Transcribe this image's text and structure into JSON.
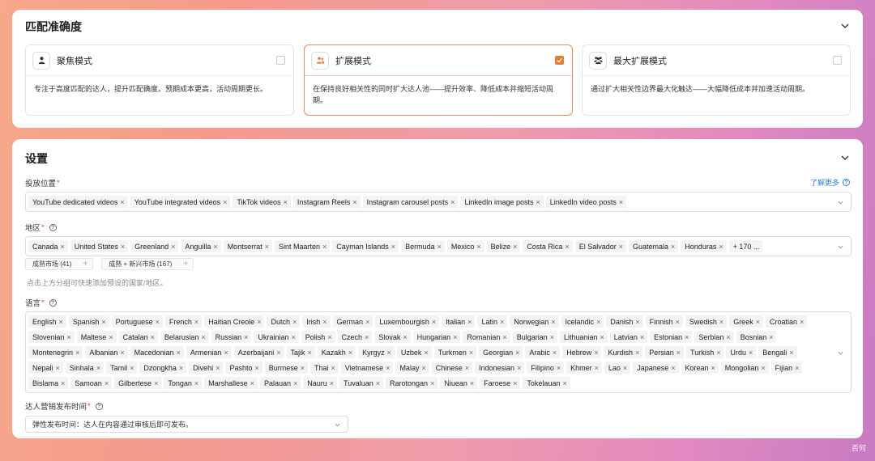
{
  "match": {
    "title": "匹配准确度",
    "modes": [
      {
        "label": "聚焦模式",
        "icon": "person-icon",
        "checked": false,
        "desc": "专注于高度匹配的达人，提升匹配确度。预期成本更高，活动周期更长。"
      },
      {
        "label": "扩展模式",
        "icon": "people-icon",
        "checked": true,
        "desc": "在保持良好相关性的同时扩大达人池——提升效率、降低成本并缩短活动周期。"
      },
      {
        "label": "最大扩展模式",
        "icon": "group-icon",
        "checked": false,
        "desc": "通过扩大相关性边界最大化触达——大幅降低成本并加速活动周期。"
      }
    ]
  },
  "settings": {
    "title": "设置",
    "placement": {
      "label": "投放位置",
      "learn_more": "了解更多",
      "tags": [
        "YouTube dedicated videos",
        "YouTube integrated videos",
        "TikTok videos",
        "Instagram Reels",
        "Instagram carousel posts",
        "LinkedIn image posts",
        "LinkedIn video posts"
      ]
    },
    "region": {
      "label": "地区",
      "tags": [
        "Canada",
        "United States",
        "Greenland",
        "Anguilla",
        "Montserrat",
        "Sint Maarten",
        "Cayman Islands",
        "Bermuda",
        "Mexico",
        "Belize",
        "Costa Rica",
        "El Salvador",
        "Guatemala",
        "Honduras"
      ],
      "more": "+ 170 ...",
      "presets": [
        "成熟市场 (41)",
        "成熟 + 新兴市场 (167)"
      ],
      "hint": "点击上方分组可快速添加预设的国家/地区。"
    },
    "language": {
      "label": "语言",
      "tags": [
        "English",
        "Spanish",
        "Portuguese",
        "French",
        "Haitian Creole",
        "Dutch",
        "Irish",
        "German",
        "Luxembourgish",
        "Italian",
        "Latin",
        "Norwegian",
        "Icelandic",
        "Danish",
        "Finnish",
        "Swedish",
        "Greek",
        "Croatian",
        "Slovenian",
        "Maltese",
        "Catalan",
        "Belarusian",
        "Russian",
        "Ukrainian",
        "Polish",
        "Czech",
        "Slovak",
        "Hungarian",
        "Romanian",
        "Bulgarian",
        "Lithuanian",
        "Latvian",
        "Estonian",
        "Serbian",
        "Bosnian",
        "Montenegrin",
        "Albanian",
        "Macedonian",
        "Armenian",
        "Azerbaijani",
        "Tajik",
        "Kazakh",
        "Kyrgyz",
        "Uzbek",
        "Turkmen",
        "Georgian",
        "Arabic",
        "Hebrew",
        "Kurdish",
        "Persian",
        "Turkish",
        "Urdu",
        "Bengali",
        "Nepali",
        "Sinhala",
        "Tamil",
        "Dzongkha",
        "Divehi",
        "Pashto",
        "Burmese",
        "Thai",
        "Vietnamese",
        "Malay",
        "Chinese",
        "Indonesian",
        "Filipino",
        "Khmer",
        "Lao",
        "Japanese",
        "Korean",
        "Mongolian",
        "Fijian",
        "Bislama",
        "Samoan",
        "Gilbertese",
        "Tongan",
        "Marshallese",
        "Palauan",
        "Nauru",
        "Tuvaluan",
        "Rarotongan",
        "Niuean",
        "Faroese",
        "Tokelauan"
      ]
    },
    "publish_time": {
      "label": "达人营销发布时间",
      "value": "弹性发布时间：达人在内容通过审核后即可发布。"
    }
  },
  "watermark": "否何",
  "colors": {
    "accent": "#ee7a32",
    "link": "#2f7de1",
    "required": "#e54040"
  }
}
